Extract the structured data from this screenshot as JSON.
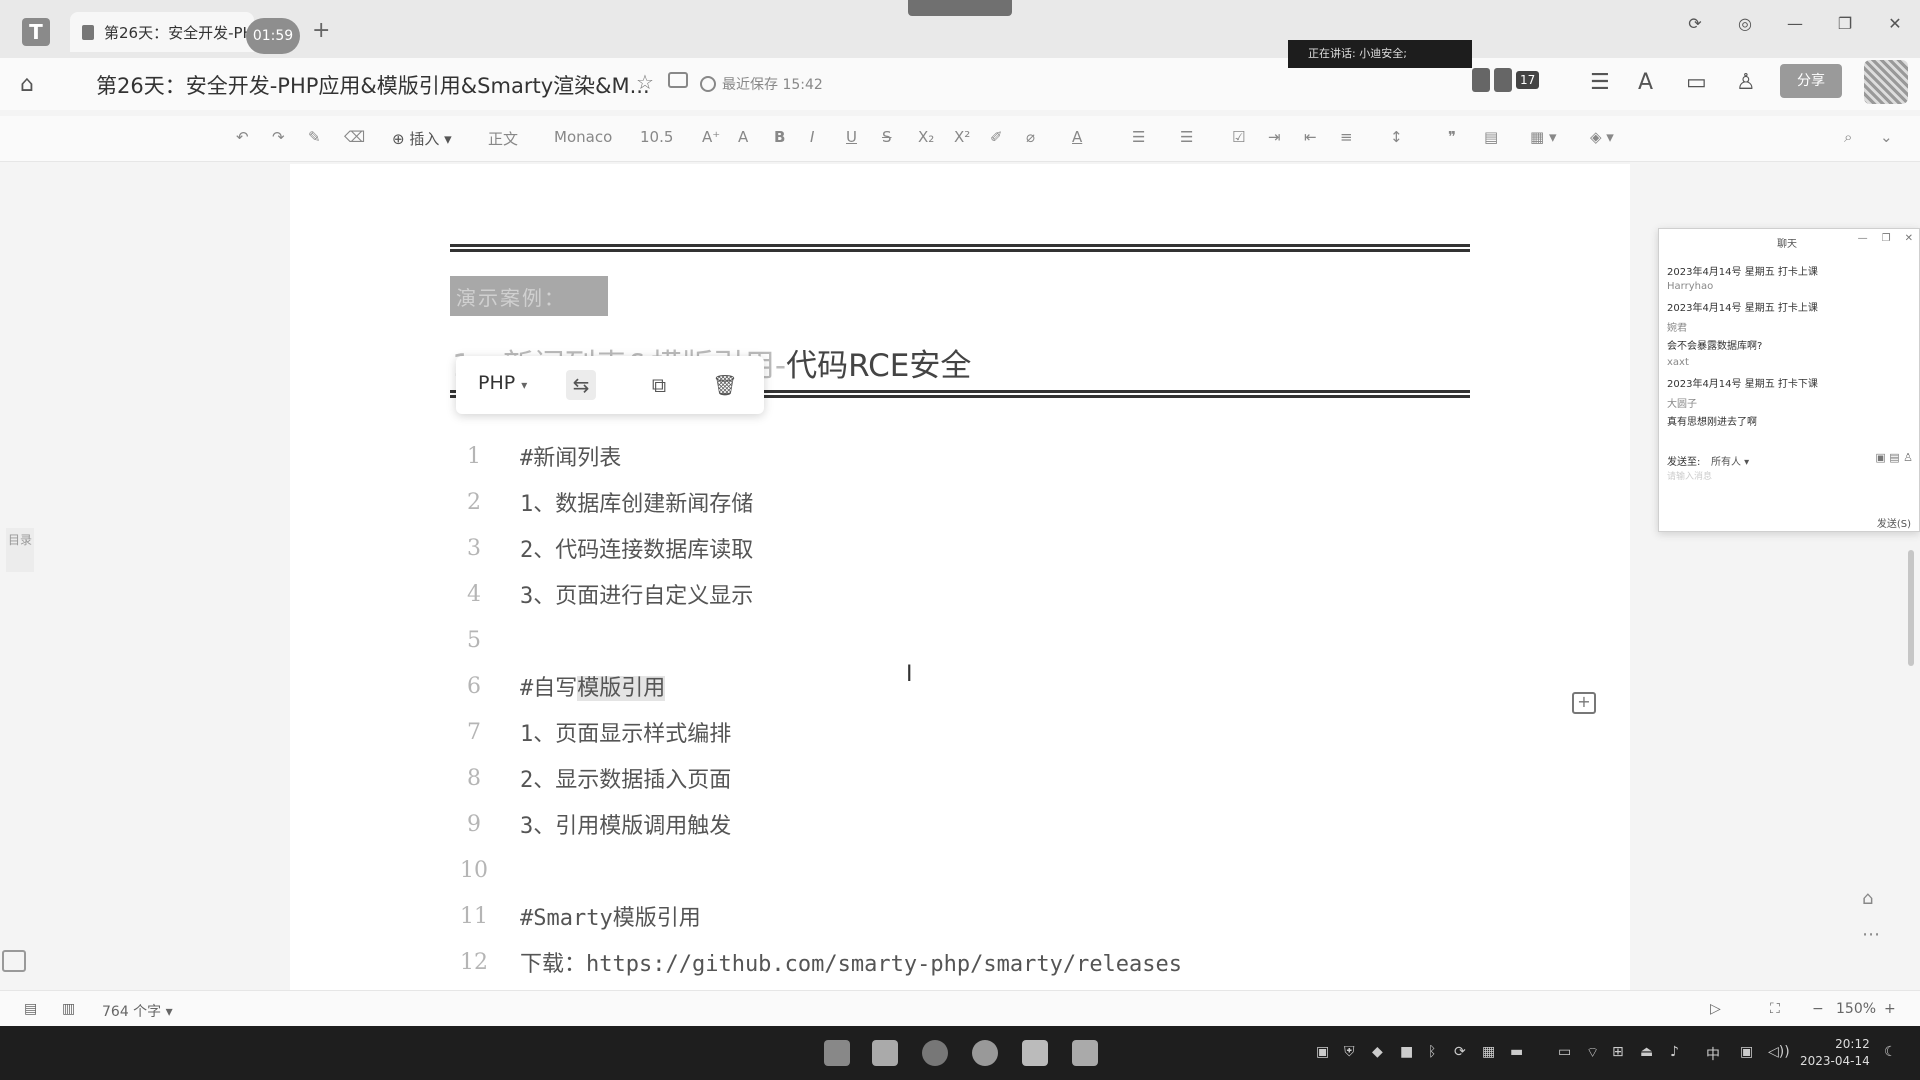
{
  "tab": {
    "title": "第26天：安全开发-PHP",
    "timer": "01:59",
    "new_tab": "+"
  },
  "window_controls": [
    "⟳",
    "◎",
    "—",
    "❐",
    "✕"
  ],
  "header": {
    "title": "第26天：安全开发-PHP应用&模版引用&Smarty渲染&M...",
    "save_status": "最近保存 15:42",
    "speaking": "正在讲话: 小迪安全;",
    "member_count": "17",
    "share_label": "分享"
  },
  "toolbar": {
    "insert_label": "插入",
    "style_label": "正文",
    "font_label": "Monaco",
    "size_label": "10.5"
  },
  "document": {
    "highlight_text": "演示案例：",
    "heading_prefix": "1、新闻列表&模版引用-",
    "heading_main": "代码RCE安全",
    "code_lang": "PHP",
    "lines": [
      {
        "num": "1",
        "text": "#新闻列表"
      },
      {
        "num": "2",
        "text": "1、数据库创建新闻存储"
      },
      {
        "num": "3",
        "text": "2、代码连接数据库读取"
      },
      {
        "num": "4",
        "text": "3、页面进行自定义显示"
      },
      {
        "num": "5",
        "text": ""
      },
      {
        "num": "6",
        "text": "#自写",
        "mark": "模版引用"
      },
      {
        "num": "7",
        "text": "1、页面显示样式编排"
      },
      {
        "num": "8",
        "text": "2、显示数据插入页面"
      },
      {
        "num": "9",
        "text": "3、引用模版调用触发"
      },
      {
        "num": "10",
        "text": ""
      },
      {
        "num": "11",
        "text": "#Smarty模版引用"
      },
      {
        "num": "12",
        "text": "下载：https://github.com/smarty-php/smarty/releases"
      }
    ]
  },
  "sidebar": {
    "catalog_label": "目录"
  },
  "chat": {
    "title": "聊天",
    "messages": [
      {
        "type": "text",
        "text": "2023年4月14号 星期五 打卡上课"
      },
      {
        "type": "sender",
        "text": "Harryhao"
      },
      {
        "type": "text",
        "text": "2023年4月14号 星期五 打卡上课"
      },
      {
        "type": "sender",
        "text": "婉君"
      },
      {
        "type": "text",
        "text": "会不会暴露数据库啊?"
      },
      {
        "type": "sender",
        "text": "xaxt"
      },
      {
        "type": "text",
        "text": "2023年4月14号 星期五 打卡下课"
      },
      {
        "type": "sender",
        "text": "大圆子"
      },
      {
        "type": "text",
        "text": "真有思想刚进去了啊"
      }
    ],
    "send_to_label": "发送至:",
    "send_to_value": "所有人",
    "input_placeholder": "请输入消息",
    "send_label": "发送(S)"
  },
  "statusbar": {
    "word_count": "764 个字",
    "zoom": "150%"
  },
  "clock": {
    "time": "20:12",
    "date": "2023-04-14"
  },
  "tray": {
    "ime": "中"
  },
  "colors": {
    "accent": "#9a9a9a",
    "taskbar": "#1e1e1e"
  }
}
